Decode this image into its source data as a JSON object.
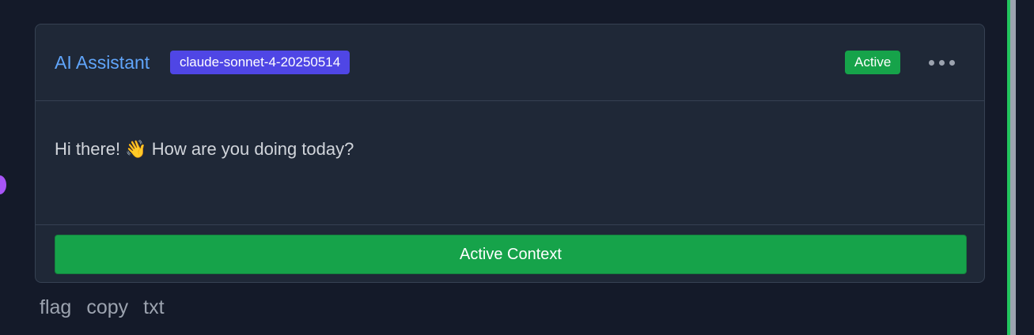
{
  "card": {
    "title": "AI Assistant",
    "model": "claude-sonnet-4-20250514",
    "status": "Active",
    "more_icon": "ellipsis-icon",
    "message": "Hi there! 👋 How are you doing today?",
    "context_button_label": "Active Context"
  },
  "actions": {
    "flag": "flag",
    "copy": "copy",
    "txt": "txt"
  },
  "colors": {
    "background": "#141a29",
    "card": "#1f2837",
    "title": "#60a5fa",
    "model_tag": "#4f46e5",
    "status_active": "#16a34a",
    "node_dot": "#a855f7",
    "rail": "#22c55e"
  }
}
